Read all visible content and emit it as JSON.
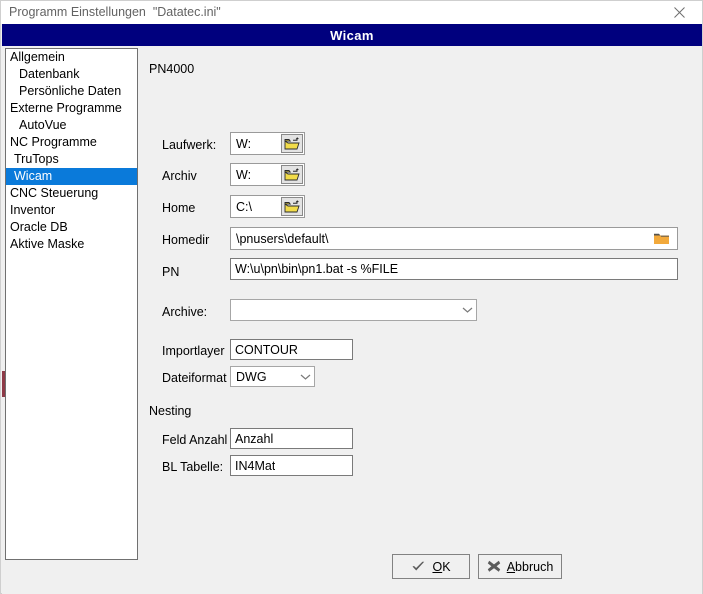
{
  "window": {
    "title": "Programm Einstellungen  \"Datatec.ini\"",
    "close_icon": "close-icon",
    "header_title": "Wicam",
    "header_color": "#00007e",
    "selection_color": "#0a7ada"
  },
  "ghost": {
    "text": ""
  },
  "sidebar": {
    "items": [
      {
        "label": "Allgemein",
        "indent": 0,
        "selected": false
      },
      {
        "label": "Datenbank",
        "indent": 1,
        "selected": false
      },
      {
        "label": "Persönliche Daten",
        "indent": 1,
        "selected": false
      },
      {
        "label": "Externe Programme",
        "indent": 0,
        "selected": false
      },
      {
        "label": "AutoVue",
        "indent": 1,
        "selected": false
      },
      {
        "label": "NC Programme",
        "indent": 0,
        "selected": false
      },
      {
        "label": "TruTops",
        "indent": 2,
        "selected": false
      },
      {
        "label": "Wicam",
        "indent": 2,
        "selected": true
      },
      {
        "label": "CNC Steuerung",
        "indent": 0,
        "selected": false
      },
      {
        "label": "Inventor",
        "indent": 0,
        "selected": false
      },
      {
        "label": "Oracle DB",
        "indent": 0,
        "selected": false
      },
      {
        "label": "Aktive Maske",
        "indent": 0,
        "selected": false
      }
    ]
  },
  "content": {
    "group_pn4000": "PN4000",
    "group_nesting": "Nesting",
    "fields": {
      "laufwerk": {
        "label": "Laufwerk:",
        "value": "W:",
        "browse_icon": "folder-open-browse-icon"
      },
      "archiv": {
        "label": "Archiv",
        "value": "W:",
        "browse_icon": "folder-open-browse-icon"
      },
      "home": {
        "label": "Home",
        "value": "C:\\",
        "browse_icon": "folder-open-browse-icon"
      },
      "homedir": {
        "label": "Homedir",
        "value": "\\pnusers\\default\\",
        "browse_icon": "folder-icon"
      },
      "pn": {
        "label": "PN",
        "value": "W:\\u\\pn\\bin\\pn1.bat -s %FILE"
      },
      "archive": {
        "label": "Archive:",
        "value": "",
        "arrow_icon": "chevron-down-icon"
      },
      "importlayer": {
        "label": "Importlayer",
        "value": "CONTOUR"
      },
      "dateiformat": {
        "label": "Dateiformat",
        "value": "DWG",
        "arrow_icon": "chevron-down-icon"
      },
      "feld_anzahl": {
        "label": "Feld Anzahl",
        "value": "Anzahl"
      },
      "bl_tabelle": {
        "label": "BL Tabelle:",
        "value": "IN4Mat"
      }
    }
  },
  "buttons": {
    "ok": {
      "label_pre": "",
      "accel": "O",
      "label_post": "K",
      "icon": "check-icon"
    },
    "abbruch": {
      "label_pre": "",
      "accel": "A",
      "label_post": "bbruch",
      "icon": "x-mark-icon"
    }
  }
}
